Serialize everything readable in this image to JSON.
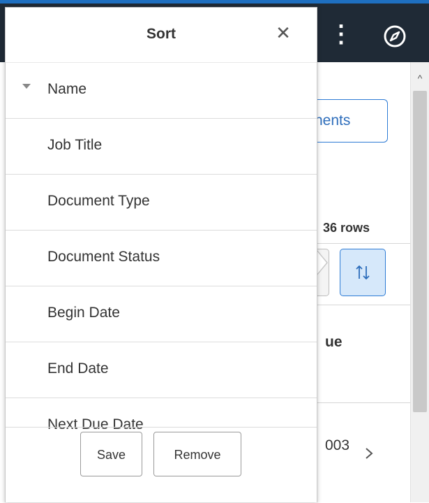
{
  "background": {
    "header": {
      "menu_icon": "kebab-vertical-icon",
      "nav_icon": "compass-icon"
    },
    "documents_button_fragment": "nents",
    "row_count": "36 rows",
    "sort_button_icon": "sort-arrows-icon",
    "column_header_fragment": "ue",
    "cell_value_fragment": "003"
  },
  "sort_dialog": {
    "title": "Sort",
    "close_icon": "close-icon",
    "items": [
      {
        "label": "Name",
        "sorted": true
      },
      {
        "label": "Job Title"
      },
      {
        "label": "Document Type"
      },
      {
        "label": "Document Status"
      },
      {
        "label": "Begin Date"
      },
      {
        "label": "End Date"
      },
      {
        "label": "Next Due Date"
      }
    ],
    "save_label": "Save",
    "remove_label": "Remove"
  },
  "colors": {
    "header_bg": "#1f2a36",
    "accent": "#2d7bd5",
    "sort_button_bg": "#d6e8fa"
  }
}
